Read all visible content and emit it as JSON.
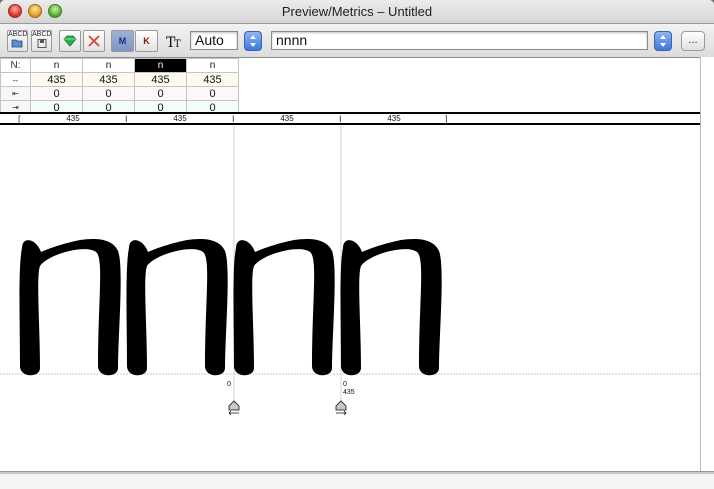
{
  "window": {
    "title": "Preview/Metrics – Untitled"
  },
  "toolbar": {
    "open_font_label_top": "ABCD",
    "save_label_top": "ABCD",
    "metrics_mode_label": "M",
    "kerning_mode_label": "K",
    "size_value": "Auto",
    "text_value": "nnnn",
    "more_label": "...",
    "icons": {
      "open": "folder-open-icon",
      "save": "save-icon",
      "apply": "green-gem-icon",
      "clear": "red-x-icon",
      "text_size": "text-size-icon"
    }
  },
  "metrics_table": {
    "row_headers": [
      "N:",
      "↔",
      "⇤",
      "⇥"
    ],
    "glyphs": [
      "n",
      "n",
      "n",
      "n"
    ],
    "selected_index": 2,
    "widths": [
      "435",
      "435",
      "435",
      "435"
    ],
    "lsb": [
      "0",
      "0",
      "0",
      "0"
    ],
    "rsb": [
      "0",
      "0",
      "0",
      "0"
    ]
  },
  "ruler": {
    "values": [
      "435",
      "435",
      "435",
      "435"
    ]
  },
  "preview": {
    "glyph_char": "n",
    "glyph_count": 4,
    "selected_index": 2,
    "left_marker_value": "0",
    "right_marker_value": "0",
    "right_marker_width": "435"
  },
  "colors": {
    "selected_cell": "#000000",
    "glyph_fill": "#000000",
    "stepper_blue": "#3c78dc"
  }
}
